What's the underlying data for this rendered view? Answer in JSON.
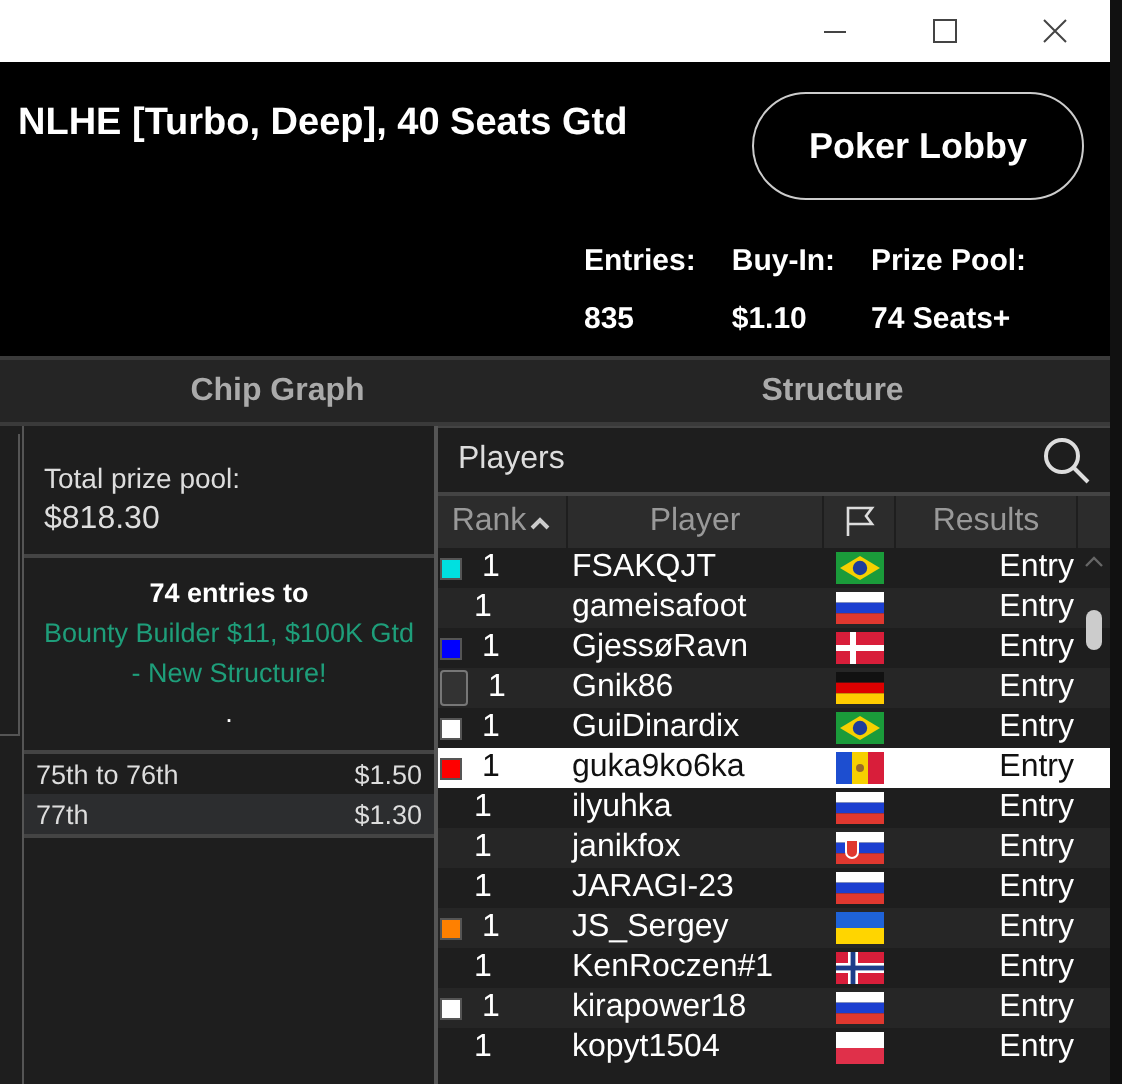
{
  "header": {
    "title": "NLHE [Turbo, Deep], 40 Seats Gtd",
    "lobby_button": "Poker Lobby",
    "stats": [
      {
        "label": "Entries:",
        "value": "835"
      },
      {
        "label": "Buy-In:",
        "value": "$1.10"
      },
      {
        "label": "Prize Pool:",
        "value": "74 Seats+"
      }
    ]
  },
  "tabs": [
    {
      "label": "Chip Graph",
      "selected": false
    },
    {
      "label": "Structure",
      "selected": false
    }
  ],
  "prizes": {
    "total_label": "Total prize pool:",
    "total": "$818.30",
    "note_prefix": "74 entries to",
    "note_link": "Bounty Builder $11, $100K Gtd - New Structure!",
    "note_suffix": ".",
    "rows": [
      {
        "place": "75th to 76th",
        "amount": "$1.50"
      },
      {
        "place": "77th",
        "amount": "$1.30"
      }
    ]
  },
  "players": {
    "title": "Players",
    "columns": [
      "Rank",
      "Player",
      "Results"
    ],
    "rows": [
      {
        "marker": {
          "kind": "square",
          "color": "#00e0e0"
        },
        "rank": "1",
        "name": "FSAKQJT",
        "flag": {
          "kind": "br"
        },
        "result": "Entry",
        "selected": false
      },
      {
        "rank": "1",
        "name": "gameisafoot",
        "flag": {
          "kind": "ru"
        },
        "result": "Entry",
        "selected": false
      },
      {
        "marker": {
          "kind": "square",
          "color": "#0000ff"
        },
        "rank": "1",
        "name": "GjessøRavn",
        "flag": {
          "kind": "dk"
        },
        "result": "Entry",
        "selected": false
      },
      {
        "marker": {
          "kind": "note"
        },
        "rank": "1",
        "name": "Gnik86",
        "flag": {
          "kind": "de"
        },
        "result": "Entry",
        "selected": false
      },
      {
        "marker": {
          "kind": "square",
          "color": "#ffffff"
        },
        "rank": "1",
        "name": "GuiDinardix",
        "flag": {
          "kind": "br"
        },
        "result": "Entry",
        "selected": false
      },
      {
        "marker": {
          "kind": "square",
          "color": "#ff0000"
        },
        "rank": "1",
        "name": "guka9ko6ka",
        "flag": {
          "kind": "md"
        },
        "result": "Entry",
        "selected": true
      },
      {
        "rank": "1",
        "name": "ilyuhka",
        "flag": {
          "kind": "ru"
        },
        "result": "Entry",
        "selected": false
      },
      {
        "rank": "1",
        "name": "janikfox",
        "flag": {
          "kind": "sk"
        },
        "result": "Entry",
        "selected": false
      },
      {
        "rank": "1",
        "name": "JARAGI-23",
        "flag": {
          "kind": "ru"
        },
        "result": "Entry",
        "selected": false
      },
      {
        "marker": {
          "kind": "square",
          "color": "#ff8000"
        },
        "rank": "1",
        "name": "JS_Sergey",
        "flag": {
          "kind": "ua"
        },
        "result": "Entry",
        "selected": false
      },
      {
        "rank": "1",
        "name": "KenRoczen#1",
        "flag": {
          "kind": "no"
        },
        "result": "Entry",
        "selected": false
      },
      {
        "marker": {
          "kind": "square",
          "color": "#ffffff"
        },
        "rank": "1",
        "name": "kirapower18",
        "flag": {
          "kind": "ru"
        },
        "result": "Entry",
        "selected": false
      },
      {
        "rank": "1",
        "name": "kopyt1504",
        "flag": {
          "kind": "pl"
        },
        "result": "Entry",
        "selected": false
      }
    ]
  }
}
